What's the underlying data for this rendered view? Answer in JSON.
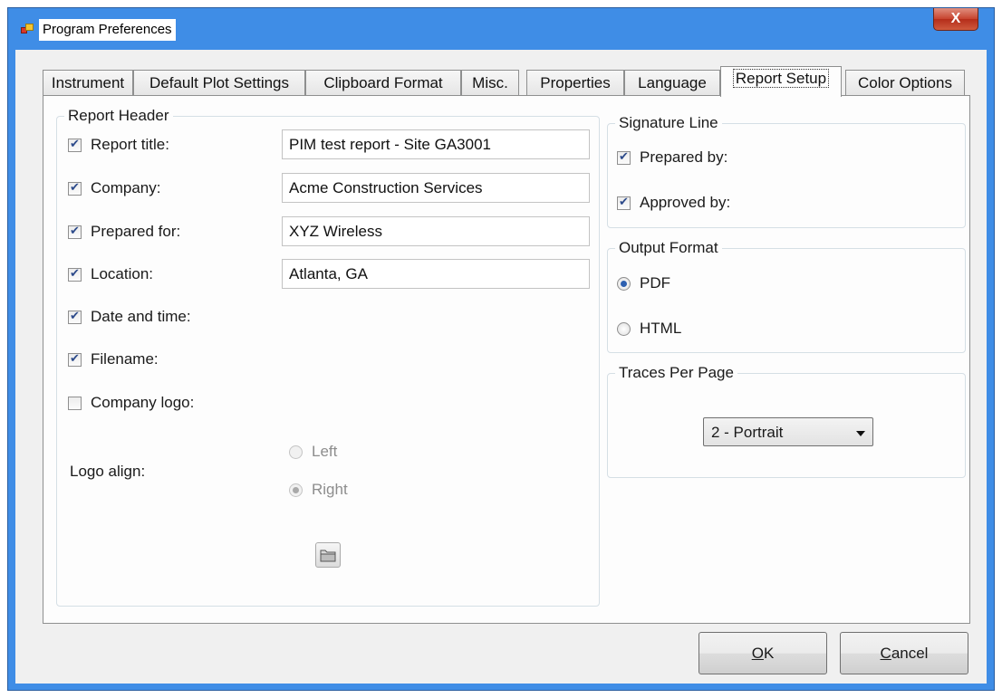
{
  "window": {
    "title": "Program Preferences",
    "close_glyph": "X"
  },
  "tabs": [
    {
      "label": "Instrument"
    },
    {
      "label": "Default Plot Settings"
    },
    {
      "label": "Clipboard Format"
    },
    {
      "label": "Misc."
    },
    {
      "label": "Properties"
    },
    {
      "label": "Language"
    },
    {
      "label": "Report Setup",
      "active": true
    },
    {
      "label": "Color Options"
    }
  ],
  "report_header": {
    "title": "Report Header",
    "items": [
      {
        "label": "Report title:",
        "checked": true,
        "value": "PIM test report - Site GA3001"
      },
      {
        "label": "Company:",
        "checked": true,
        "value": "Acme Construction Services"
      },
      {
        "label": "Prepared for:",
        "checked": true,
        "value": "XYZ Wireless"
      },
      {
        "label": "Location:",
        "checked": true,
        "value": "Atlanta, GA"
      },
      {
        "label": "Date and time:",
        "checked": true
      },
      {
        "label": "Filename:",
        "checked": true
      },
      {
        "label": "Company logo:",
        "checked": false
      }
    ],
    "logo_align": {
      "label": "Logo align:",
      "options": [
        {
          "label": "Left",
          "selected": false
        },
        {
          "label": "Right",
          "selected": true
        }
      ],
      "enabled": false
    },
    "browse_icon": "folder-icon"
  },
  "signature_line": {
    "title": "Signature Line",
    "items": [
      {
        "label": "Prepared by:",
        "checked": true
      },
      {
        "label": "Approved by:",
        "checked": true
      }
    ]
  },
  "output_format": {
    "title": "Output Format",
    "options": [
      {
        "label": "PDF",
        "selected": true
      },
      {
        "label": "HTML",
        "selected": false
      }
    ]
  },
  "traces_per_page": {
    "title": "Traces Per Page",
    "selected": "2 - Portrait"
  },
  "buttons": {
    "ok": {
      "mnemonic": "O",
      "rest": "K"
    },
    "cancel": {
      "mnemonic": "C",
      "rest": "ancel"
    }
  },
  "colors": {
    "title_bar": "#3f8de6",
    "close_button": "#c7432e",
    "dialog_bg": "#f0f0f0",
    "radio_dot": "#2c5fb0"
  }
}
